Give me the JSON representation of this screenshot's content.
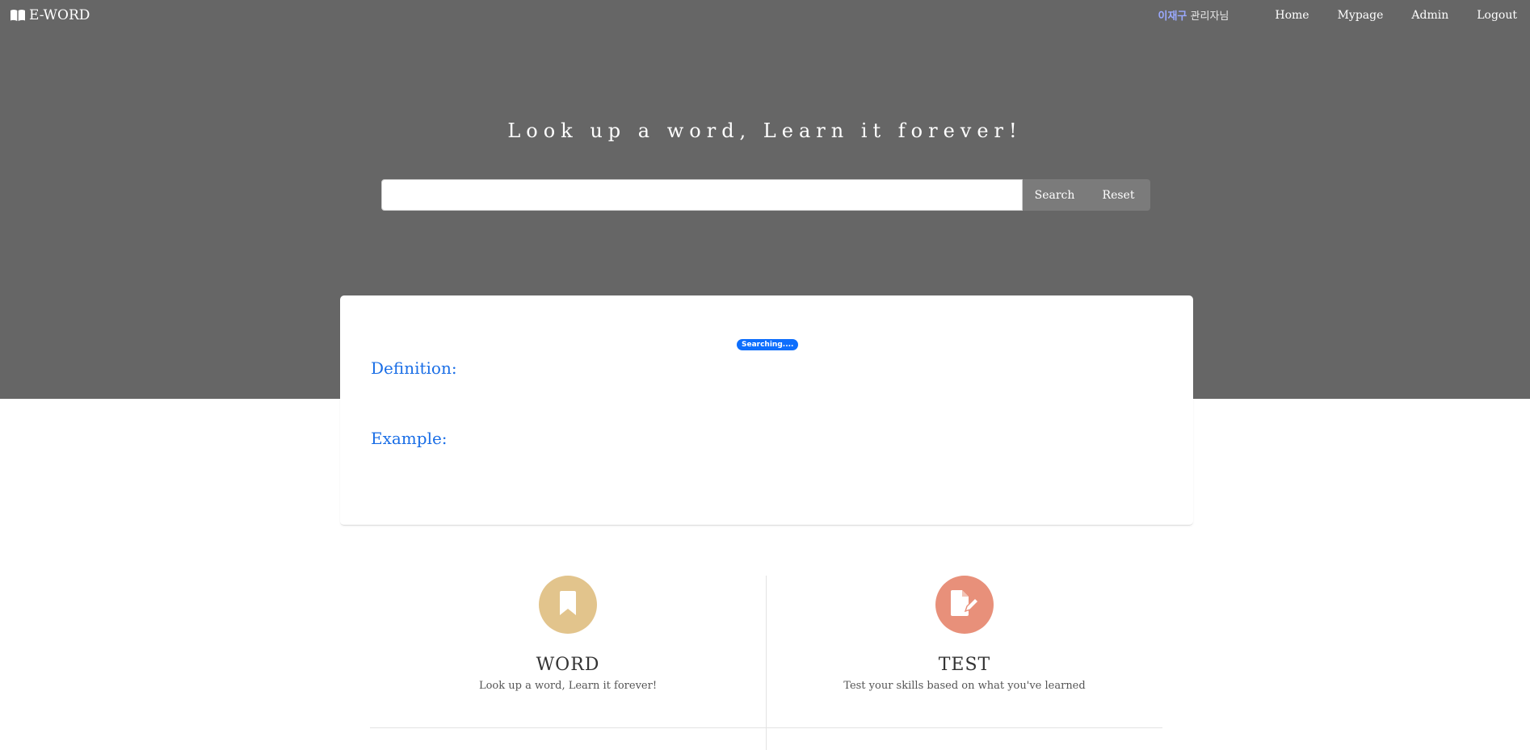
{
  "navbar": {
    "brand": "E-WORD",
    "brand_icon": "book-open-icon",
    "user_name": "이재구",
    "user_suffix": " 관리자님",
    "links": [
      "Home",
      "Mypage",
      "Admin",
      "Logout"
    ]
  },
  "hero": {
    "title": "Look up a word, Learn it forever!",
    "background": "#666666"
  },
  "search": {
    "value": "",
    "placeholder": "",
    "search_label": "Search",
    "reset_label": "Reset"
  },
  "result": {
    "status_badge": "Searching....",
    "definition_label": "Definition:",
    "example_label": "Example:",
    "accent_color": "#1a6ee6"
  },
  "features": [
    {
      "title": "WORD",
      "description": "Look up a word, Learn it forever!",
      "icon": "bookmark-icon",
      "color": "#e2c48c"
    },
    {
      "title": "TEST",
      "description": "Test your skills based on what you've learned",
      "icon": "file-edit-icon",
      "color": "#e8907a"
    }
  ]
}
